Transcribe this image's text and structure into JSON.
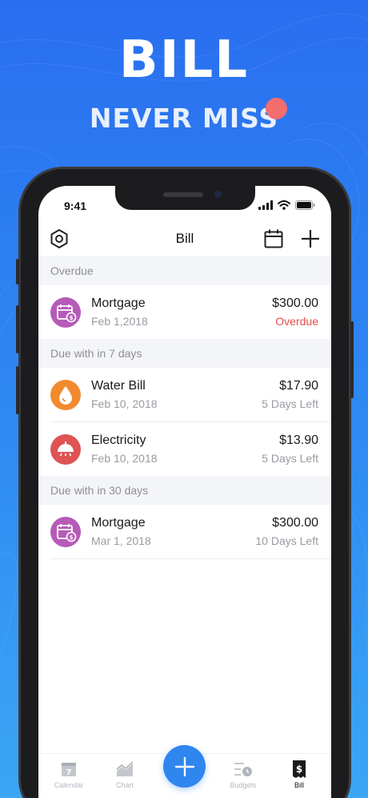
{
  "hero": {
    "title": "BILL",
    "subtitle": "NEVER MISS"
  },
  "status_bar": {
    "time": "9:41"
  },
  "nav": {
    "title": "Bill",
    "left_icon": "settings-hexagon-icon",
    "right_icons": [
      "calendar-icon",
      "plus-icon"
    ]
  },
  "sections": [
    {
      "header": "Overdue",
      "bills": [
        {
          "name": "Mortgage",
          "date": "Feb 1,2018",
          "amount": "$300.00",
          "status": "Overdue",
          "icon": "calendar-dollar-icon",
          "color": "#b65bb8",
          "overdue": true
        }
      ]
    },
    {
      "header": "Due with in 7 days",
      "bills": [
        {
          "name": "Water Bill",
          "date": "Feb 10, 2018",
          "amount": "$17.90",
          "status": "5 Days Left",
          "icon": "water-drop-icon",
          "color": "#f28a2e",
          "overdue": false
        },
        {
          "name": "Electricity",
          "date": "Feb 10, 2018",
          "amount": "$13.90",
          "status": "5 Days Left",
          "icon": "lamp-icon",
          "color": "#de5454",
          "overdue": false
        }
      ]
    },
    {
      "header": "Due with in 30 days",
      "bills": [
        {
          "name": "Mortgage",
          "date": "Mar 1, 2018",
          "amount": "$300.00",
          "status": "10 Days Left",
          "icon": "calendar-dollar-icon",
          "color": "#b65bb8",
          "overdue": false
        }
      ]
    }
  ],
  "tabbar": {
    "tabs": [
      {
        "label": "Calendar",
        "icon": "calendar-7-icon",
        "active": false
      },
      {
        "label": "Chart",
        "icon": "chart-icon",
        "active": false
      },
      {
        "label": "Budgets",
        "icon": "budgets-icon",
        "active": false
      },
      {
        "label": "Bill",
        "icon": "bill-dollar-icon",
        "active": true
      }
    ],
    "fab_icon": "plus-icon"
  },
  "colors": {
    "accent": "#2f86ef",
    "overdue": "#e84b4b",
    "background_top": "#2a6ef0",
    "background_bottom": "#3aa6f5"
  }
}
